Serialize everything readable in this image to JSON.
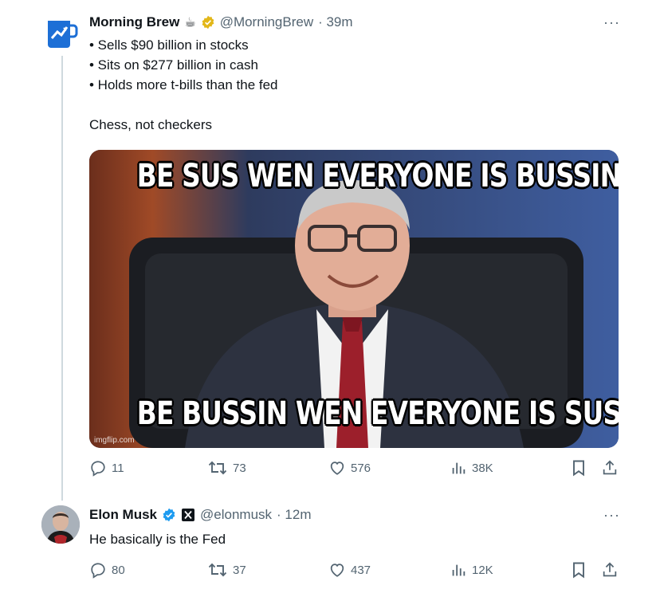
{
  "tweets": [
    {
      "name": "Morning Brew",
      "name_emoji": "☕",
      "handle": "@MorningBrew",
      "time": "· 39m",
      "lines": [
        "• Sells $90 billion in stocks",
        "• Sits on $277 billion in cash",
        "• Holds more t-bills than the fed"
      ],
      "extra": "Chess, not checkers",
      "media": {
        "top_text": "BE SUS WEN EVERYONE IS BUSSIN",
        "bottom_text": "BE BUSSIN WEN EVERYONE IS SUS",
        "source": "imgflip.com"
      },
      "replies": "11",
      "retweets": "73",
      "likes": "576",
      "views": "38K"
    },
    {
      "name": "Elon Musk",
      "handle": "@elonmusk",
      "time": "· 12m",
      "text": "He basically is the Fed",
      "replies": "80",
      "retweets": "37",
      "likes": "437",
      "views": "12K"
    }
  ],
  "more_label": "···",
  "colors": {
    "verified": "#1d9bf0",
    "badge_gold": "#e2b719",
    "secondary": "#536471"
  }
}
